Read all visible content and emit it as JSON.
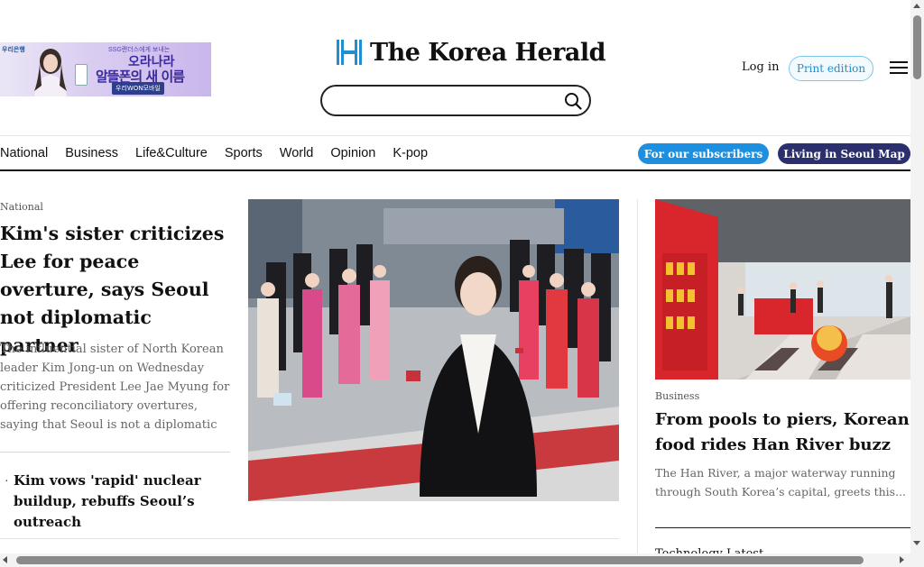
{
  "ad": {
    "bank_name": "우리은행",
    "small_copy": "SSG랜더스에게 보내는",
    "line1": "오라나라",
    "line2": "알뜰폰의 새 이름",
    "cta": "우리WON모바일"
  },
  "header": {
    "logo_text": "The Korea Herald",
    "search_placeholder": "",
    "login_label": "Log in",
    "print_label": "Print edition"
  },
  "nav": {
    "items": [
      "National",
      "Business",
      "Life&Culture",
      "Sports",
      "World",
      "Opinion",
      "K-pop"
    ],
    "subscribers_label": "For our subscribers",
    "map_label": "Living in Seoul Map"
  },
  "lead": {
    "category": "National",
    "title": "Kim's sister criticizes Lee for peace overture, says Seoul not diplomatic partner",
    "summary": "The influential sister of North Korean leader Kim Jong-un on Wednesday criticized President Lee Jae Myung for offering reconciliatory overtures, saying that Seoul is not a diplomatic partner to...",
    "related_title": "Kim vows 'rapid' nuclear buildup, rebuffs Seoul’s outreach"
  },
  "right": {
    "category": "Business",
    "title": "From pools to piers, Korean food rides Han River buzz",
    "summary": "The Han River, a major waterway running through South Korea’s capital, greets this...",
    "next_title": "Technology Latest"
  },
  "colors": {
    "subscribers_pill": "#1d8fe0",
    "map_pill": "#2c2f6e",
    "print_text": "#1f8fd0",
    "logo_mark": "#1f8fd0"
  }
}
